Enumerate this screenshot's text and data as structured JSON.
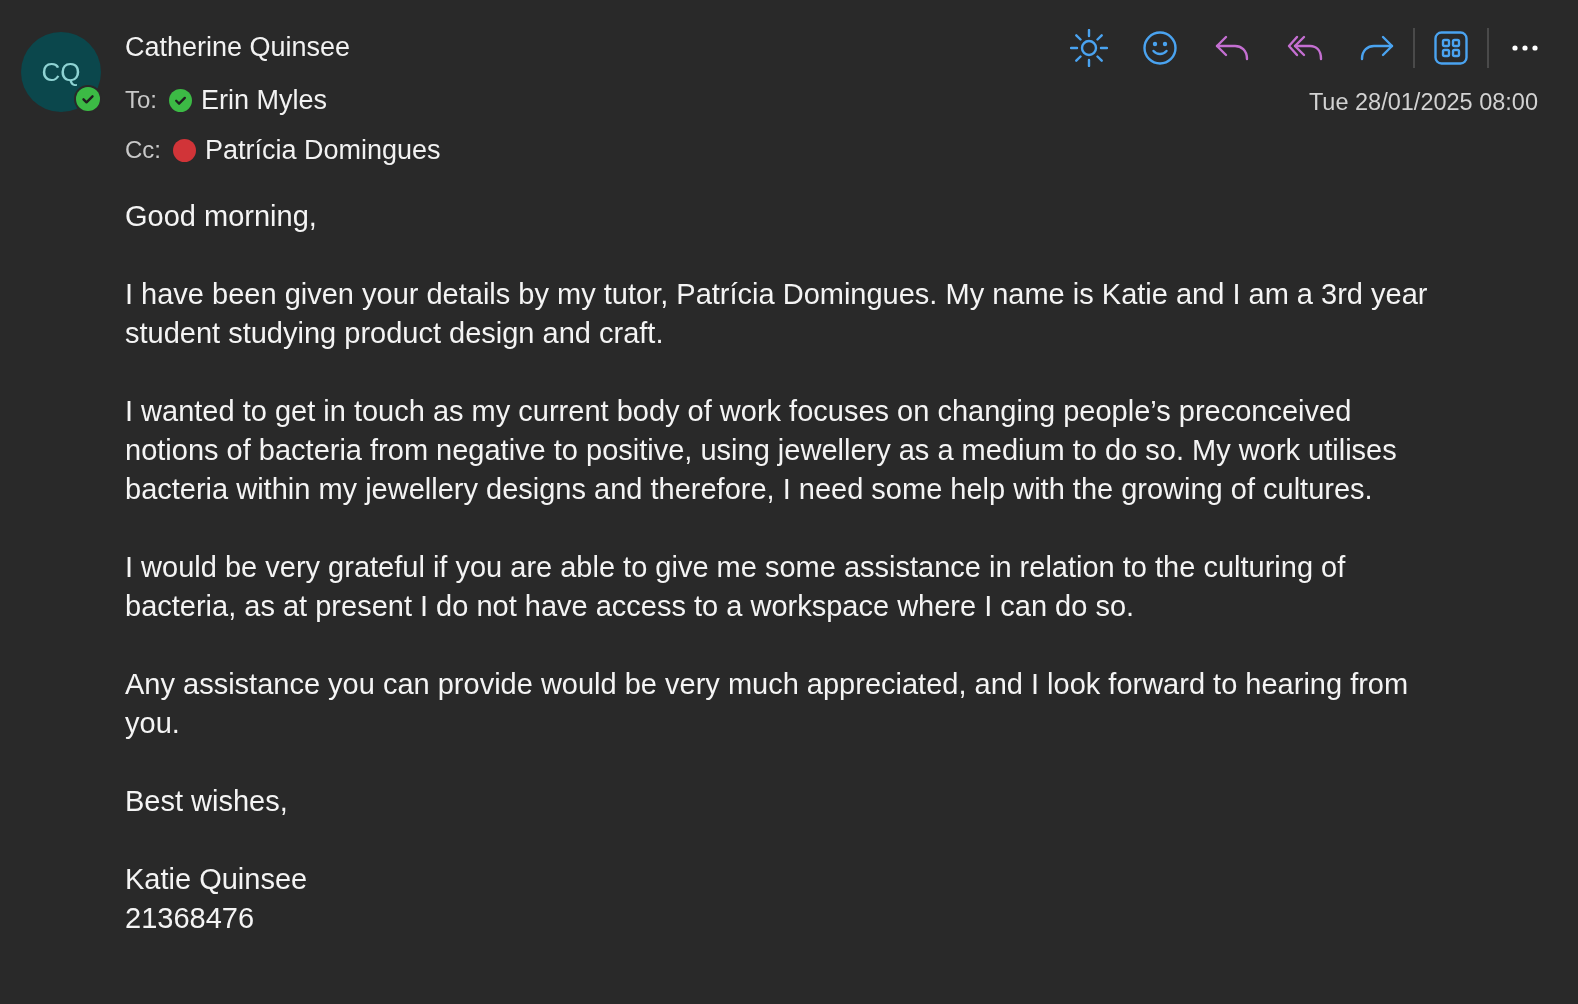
{
  "sender": {
    "initials": "CQ",
    "name": "Catherine Quinsee",
    "presence": {
      "kind": "available",
      "color": "#3cba45"
    }
  },
  "recipients": [
    {
      "label": "To:",
      "name": "Erin Myles",
      "presence": {
        "kind": "available",
        "color": "#3cba45"
      }
    },
    {
      "label": "Cc:",
      "name": "Patrícia Domingues",
      "presence": {
        "kind": "busy",
        "color": "#d13438"
      }
    }
  ],
  "date": "Tue 28/01/2025 08:00",
  "body": {
    "paragraphs": [
      "Good morning,",
      "I have been given your details by my tutor, Patrícia Domingues. My name is Katie and I am a 3rd year student studying product design and craft.",
      "I wanted to get in touch as my current body of work focuses on changing people’s preconceived notions of bacteria from negative to positive, using jewellery as a medium to do so. My work utilises bacteria within my jewellery designs and therefore, I need some help with the growing of cultures.",
      "I would be very grateful if you are able to give me some assistance in relation to the culturing of bacteria, as at present I do not have access to a workspace where I can do so.",
      "Any assistance you can provide would be very much appreciated, and I look forward to hearing from you.",
      "Best wishes,"
    ],
    "signature": [
      "Katie Quinsee",
      "21368476"
    ]
  }
}
